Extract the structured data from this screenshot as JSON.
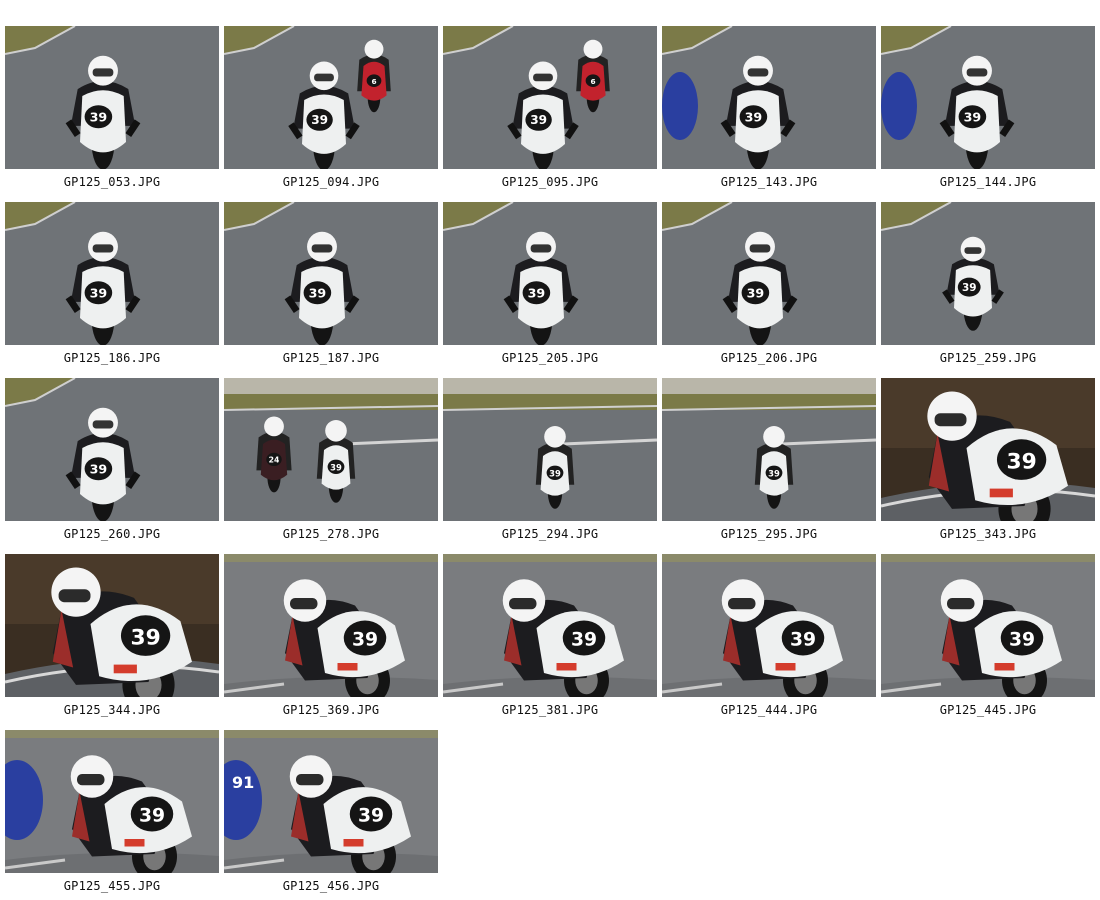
{
  "gallery": {
    "items": [
      {
        "filename": "GP125_053.JPG",
        "style": "far",
        "number": "39",
        "bg": "asphalt"
      },
      {
        "filename": "GP125_094.JPG",
        "style": "far-group",
        "number": "39",
        "bg": "asphalt",
        "second_number": "6"
      },
      {
        "filename": "GP125_095.JPG",
        "style": "far-group",
        "number": "39",
        "bg": "asphalt",
        "second_number": "6"
      },
      {
        "filename": "GP125_143.JPG",
        "style": "far-blue",
        "number": "39",
        "bg": "asphalt"
      },
      {
        "filename": "GP125_144.JPG",
        "style": "far-blue",
        "number": "39",
        "bg": "asphalt"
      },
      {
        "filename": "GP125_186.JPG",
        "style": "far",
        "number": "39",
        "bg": "asphalt"
      },
      {
        "filename": "GP125_187.JPG",
        "style": "far",
        "number": "39",
        "bg": "asphalt"
      },
      {
        "filename": "GP125_205.JPG",
        "style": "far",
        "number": "39",
        "bg": "asphalt"
      },
      {
        "filename": "GP125_206.JPG",
        "style": "far",
        "number": "39",
        "bg": "asphalt"
      },
      {
        "filename": "GP125_259.JPG",
        "style": "far-small",
        "number": "39",
        "bg": "asphalt"
      },
      {
        "filename": "GP125_260.JPG",
        "style": "far",
        "number": "39",
        "bg": "asphalt"
      },
      {
        "filename": "GP125_278.JPG",
        "style": "distant-pair",
        "number": "39",
        "bg": "track-wide",
        "second_number": "24"
      },
      {
        "filename": "GP125_294.JPG",
        "style": "distant",
        "number": "39",
        "bg": "track-wide"
      },
      {
        "filename": "GP125_295.JPG",
        "style": "distant",
        "number": "39",
        "bg": "track-wide"
      },
      {
        "filename": "GP125_343.JPG",
        "style": "close",
        "number": "39",
        "bg": "dark"
      },
      {
        "filename": "GP125_344.JPG",
        "style": "close",
        "number": "39",
        "bg": "dark"
      },
      {
        "filename": "GP125_369.JPG",
        "style": "lean",
        "number": "39",
        "bg": "wet"
      },
      {
        "filename": "GP125_381.JPG",
        "style": "lean",
        "number": "39",
        "bg": "wet"
      },
      {
        "filename": "GP125_444.JPG",
        "style": "lean",
        "number": "39",
        "bg": "wet"
      },
      {
        "filename": "GP125_445.JPG",
        "style": "lean",
        "number": "39",
        "bg": "wet"
      },
      {
        "filename": "GP125_455.JPG",
        "style": "lean-blue",
        "number": "39",
        "bg": "wet"
      },
      {
        "filename": "GP125_456.JPG",
        "style": "lean-blue",
        "number": "39",
        "bg": "wet",
        "second_number": "91"
      }
    ]
  },
  "colors": {
    "asphalt": "#6f7377",
    "grass": "#7b7a48",
    "rider_black": "#1c1c1f",
    "rider_red": "#9b2d2a",
    "bike_white": "#eef0f0",
    "helmet_white": "#f4f4f4",
    "number_plate": "#151515",
    "bike_blue": "#2a3fa0",
    "bike_red": "#c2222d"
  }
}
